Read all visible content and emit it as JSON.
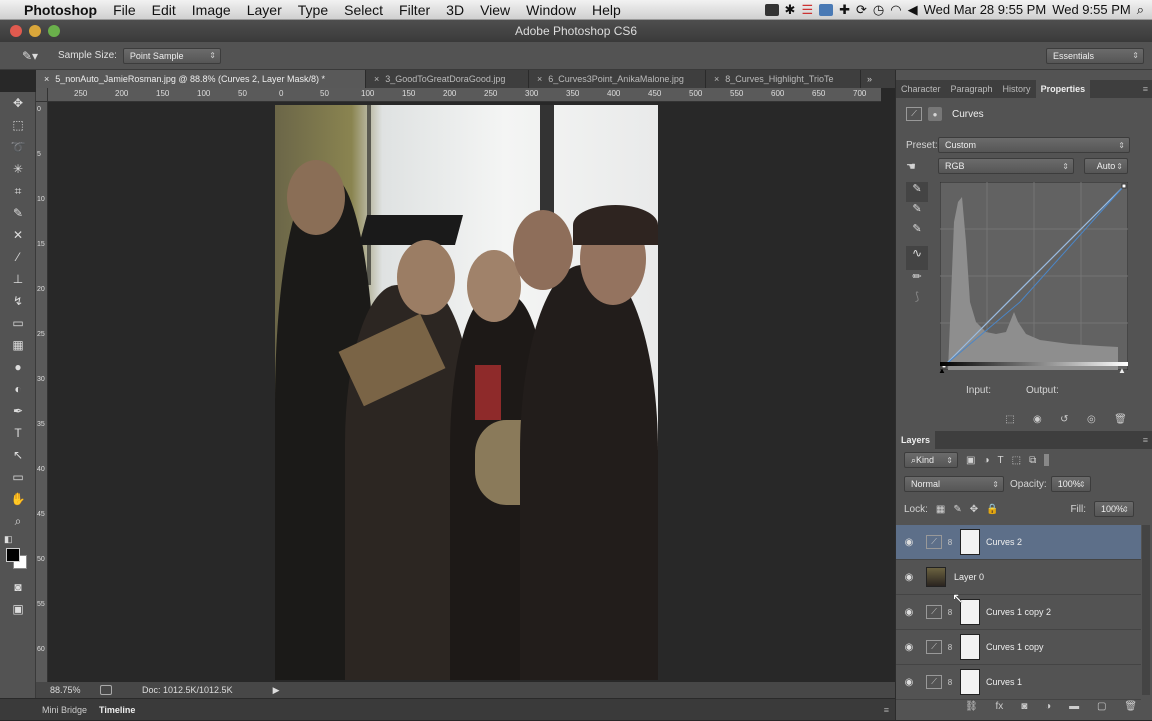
{
  "menubar": {
    "app": "Photoshop",
    "items": [
      "File",
      "Edit",
      "Image",
      "Layer",
      "Type",
      "Select",
      "Filter",
      "3D",
      "View",
      "Window",
      "Help"
    ],
    "clock": "Wed Mar 28  9:55 PM",
    "clock2": "Wed 9:55 PM"
  },
  "window": {
    "title": "Adobe Photoshop CS6"
  },
  "options": {
    "sample_size_label": "Sample Size:",
    "sample_size_value": "Point Sample",
    "workspace": "Essentials"
  },
  "doc_tabs": [
    {
      "label": "5_nonAuto_JamieRosman.jpg @ 88.8% (Curves 2, Layer Mask/8) *",
      "active": true
    },
    {
      "label": "3_GoodToGreatDoraGood.jpg",
      "active": false
    },
    {
      "label": "6_Curves3Point_AnikaMalone.jpg",
      "active": false
    },
    {
      "label": "8_Curves_Highlight_TrioTe",
      "active": false
    }
  ],
  "hruler_ticks": [
    "250",
    "200",
    "150",
    "100",
    "50",
    "0",
    "50",
    "100",
    "150",
    "200",
    "250",
    "300",
    "350",
    "400",
    "450",
    "500",
    "550",
    "600",
    "650",
    "700"
  ],
  "vruler_ticks": [
    "0",
    "5",
    "1 0",
    "1 5",
    "2 0",
    "2 5",
    "3 0",
    "3 5",
    "4 0",
    "4 5",
    "5 0",
    "5 5",
    "6 0"
  ],
  "status": {
    "zoom": "88.75%",
    "doc": "Doc: 1012.5K/1012.5K"
  },
  "bottom_tabs": [
    "Mini Bridge",
    "Timeline"
  ],
  "panel_tabs": [
    "Character",
    "Paragraph",
    "History",
    "Properties"
  ],
  "properties": {
    "title": "Curves",
    "preset_label": "Preset:",
    "preset_value": "Custom",
    "channel": "RGB",
    "auto_label": "Auto",
    "input_label": "Input:",
    "output_label": "Output:"
  },
  "layers_panel": {
    "title": "Layers",
    "kind": "Kind",
    "blend_mode": "Normal",
    "opacity_label": "Opacity:",
    "opacity_value": "100%",
    "lock_label": "Lock:",
    "fill_label": "Fill:",
    "fill_value": "100%",
    "layers": [
      {
        "name": "Curves 2",
        "type": "adjustment",
        "selected": true
      },
      {
        "name": "Layer 0",
        "type": "image",
        "selected": false
      },
      {
        "name": "Curves 1 copy 2",
        "type": "adjustment",
        "selected": false
      },
      {
        "name": "Curves 1 copy",
        "type": "adjustment",
        "selected": false
      },
      {
        "name": "Curves 1",
        "type": "adjustment",
        "selected": false
      }
    ]
  },
  "colors": {
    "accent_selected": "#5d6f89",
    "panel": "#535353",
    "canvas": "#282828"
  }
}
